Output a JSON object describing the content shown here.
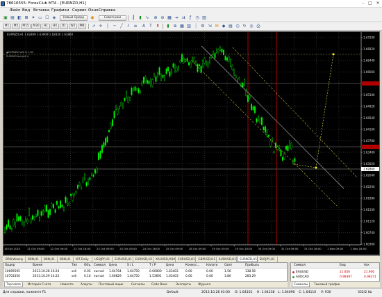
{
  "window": {
    "title": "78616555: ForexClub MT4 - [EURNZD,H1]",
    "minimize": "–",
    "maximize": "□",
    "close": "✕"
  },
  "menu": [
    "Файл",
    "Вид",
    "Вставка",
    "Графики",
    "Сервис",
    "Окно",
    "Справка"
  ],
  "toolbar": {
    "new_order": "Новый Ордер",
    "advisors": "Советники"
  },
  "timeframes": [
    "M1",
    "M5",
    "M15",
    "M30",
    "H1",
    "H4",
    "D1",
    "W1",
    "MN"
  ],
  "chart": {
    "info": "EURNZD,H1 1.62869 1.63909 1.62830 1.62860",
    "indicator_label_1": "▲EURNZD sold in 1.64",
    "indicator_label_2": "EURNZD bought in",
    "price_labels": [
      "1.67200",
      "1.66820",
      "1.66440",
      "1.66060",
      "1.65680",
      "1.65300",
      "1.64920",
      "1.64540",
      "1.64160",
      "1.63780",
      "1.63400",
      "1.63020",
      "1.62640",
      "1.62260",
      "1.61880",
      "1.61500",
      "1.61120",
      "1.60740",
      "1.60360"
    ],
    "current_price": "1.62860",
    "time_labels": [
      "18 Oct 2013",
      "21 Oct 09:00",
      "22 Oct 09:00",
      "22 Oct 16:00",
      "23 Oct 09:00",
      "24 Oct 09:00",
      "24 Oct 16:00",
      "25 Oct 09:00",
      "28 Oct 09:00",
      "29 Oct 09:00",
      "29 Oct 16:00",
      "30 Oct 09:00",
      "31 Oct 09:00",
      "31 Oct 16:00",
      "1 Nov 09:00",
      "1 Nov 16:00"
    ],
    "up_color": "#00e000",
    "down_color": "#00e000",
    "bg": "#000000"
  },
  "chart_tabs": [
    "EURNZD,H1",
    "GBPUSD,H1",
    "AUDUSD,H1",
    "EURJPY,H1",
    "USDJPY,H1",
    "USDCHF,H1",
    "EURUSD,H1",
    "GBPUSD,H1",
    "EURCHF,H1",
    "AUDCAD,H1",
    "EURNZD,H1",
    "EURJPY,H1"
  ],
  "chart_tabs_visible": [
    "BRN,Weekly",
    "BRN,H1",
    "BRN,H1",
    "BRN,H1",
    "WT,Daily",
    "USDJPY,H1",
    "EURUSD,H1",
    "EURUSD,H1",
    "XAUUSD,M30",
    "EURUSD,H1",
    "GBPUSD,H1",
    "AUDUSD,H1",
    "EURNZD,H1",
    "EURJPY,H1"
  ],
  "terminal": {
    "headers": [
      "Ордер",
      "Время",
      "Тип",
      "Объ.",
      "Символ",
      "Цена",
      "S / L",
      "T / P",
      "Цена",
      "Комисс...",
      "Налоги",
      "Своп",
      "Прибыль"
    ],
    "rows": [
      [
        "10669595",
        "2013.10.28 16:24",
        "sell",
        "0.05",
        "eurnzd",
        "1.64764",
        "1.64750",
        "0.00000",
        "1.63403",
        "0.00",
        "0.00",
        "1.56",
        "138.56"
      ],
      [
        "10703350",
        "2013.10.29 14:22",
        "sell",
        "0.10",
        "eurnzd",
        "1.66829",
        "1.64750",
        "1.53691",
        "1.63403",
        "0.00",
        "0.00",
        "3.80",
        "283.29"
      ]
    ],
    "tabs": [
      "Торговля",
      "История Счета",
      "Новости",
      "Алерты",
      "Почтовый ящик",
      "Сигналы",
      "Code Base",
      "Эксперты",
      "Журнал"
    ]
  },
  "watch": {
    "headers": [
      "Символ",
      "Бид",
      "Аск"
    ],
    "rows": [
      [
        "EAGUSD",
        "21.856",
        "21.906"
      ],
      [
        "AUDCAD",
        "0.98397",
        "0.98371"
      ]
    ],
    "tabs": [
      "Символы",
      "Тиковый график"
    ]
  },
  "status": {
    "help": "Для справки, нажмите F1",
    "profile": "Default",
    "time": "2013.10.28 03:00",
    "o": "O: 1.64161",
    "h": "H: 1.64238",
    "l": "L: 1.64090",
    "c": "C: 1.64110",
    "v": "V: 930",
    "traffic": "332/2 kb"
  }
}
